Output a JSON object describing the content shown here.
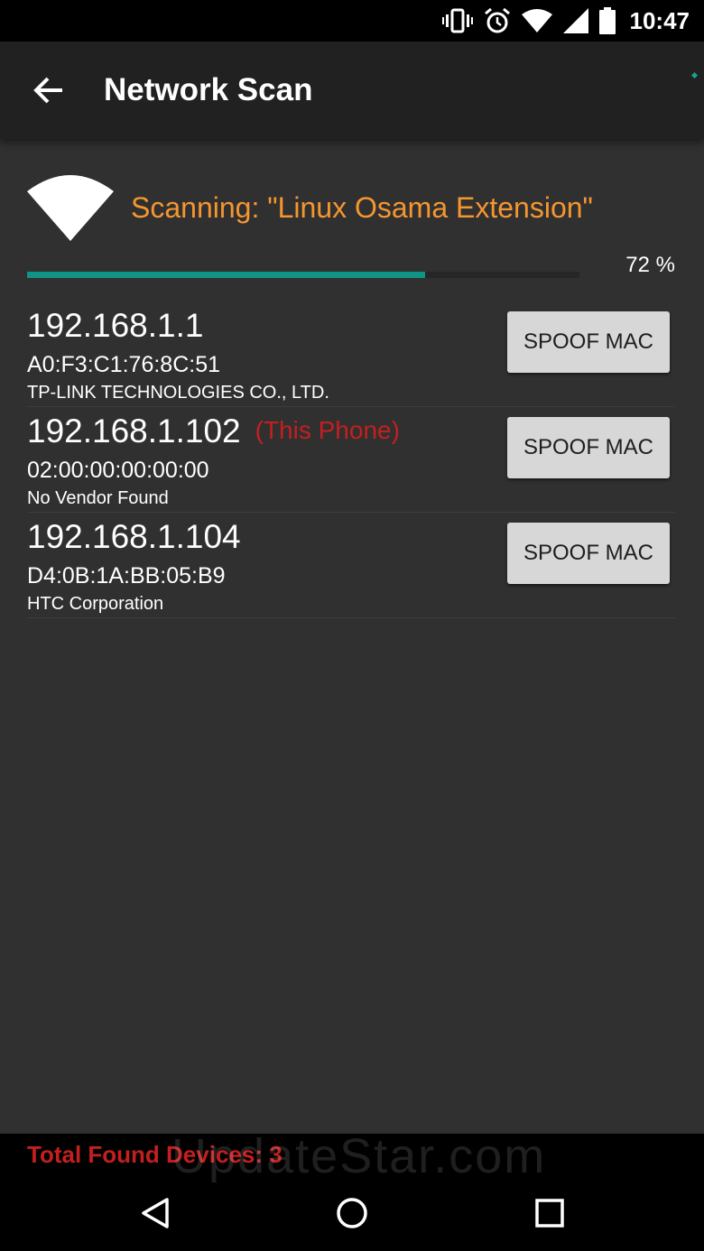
{
  "status_bar": {
    "time": "10:47",
    "icons": [
      "vibrate-icon",
      "alarm-icon",
      "wifi-signal-icon",
      "cell-signal-icon",
      "battery-icon"
    ]
  },
  "app_bar": {
    "title": "Network Scan",
    "back_icon": "arrow-back-icon"
  },
  "scan": {
    "label": "Scanning: \"Linux Osama Extension\"",
    "progress_text": "72 %",
    "progress_percent": 72,
    "progress_color": "#0f9486",
    "label_color": "#f5962f"
  },
  "devices": [
    {
      "ip": "192.168.1.1",
      "note": "",
      "mac": "A0:F3:C1:76:8C:51",
      "vendor": "TP-LINK TECHNOLOGIES CO., LTD.",
      "button": "SPOOF MAC"
    },
    {
      "ip": "192.168.1.102",
      "note": "(This Phone)",
      "mac": "02:00:00:00:00:00",
      "vendor": "No Vendor Found",
      "button": "SPOOF MAC"
    },
    {
      "ip": "192.168.1.104",
      "note": "",
      "mac": "D4:0B:1A:BB:05:B9",
      "vendor": "HTC Corporation",
      "button": "SPOOF MAC"
    }
  ],
  "footer": {
    "total_found": "Total Found Devices: 3",
    "total_color": "#c41f1f"
  },
  "watermark": "UpdateStar.com",
  "nav": {
    "icons": [
      "nav-back-icon",
      "nav-home-icon",
      "nav-recents-icon"
    ]
  }
}
